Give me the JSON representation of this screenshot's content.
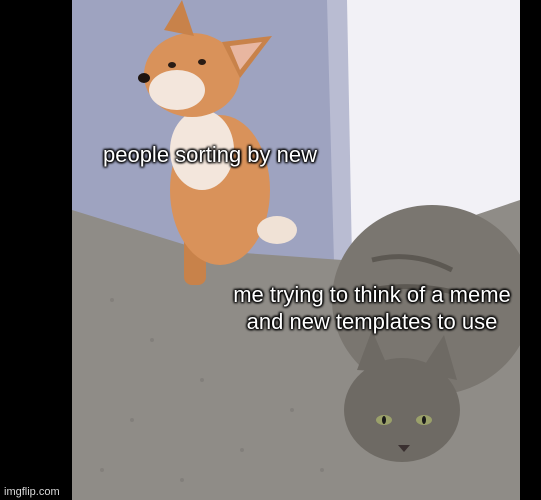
{
  "captions": {
    "top": "people sorting by new",
    "bottom": "me trying to think of a meme and new templates to use"
  },
  "watermark": "imgflip.com",
  "colors": {
    "background": "#000000",
    "wall_left": "#9ea3c0",
    "wall_right": "#f2f1f6",
    "carpet": "#8f8c87",
    "dog": "#d9925a",
    "cat": "#7a7670",
    "caption_text": "#ffffff"
  }
}
